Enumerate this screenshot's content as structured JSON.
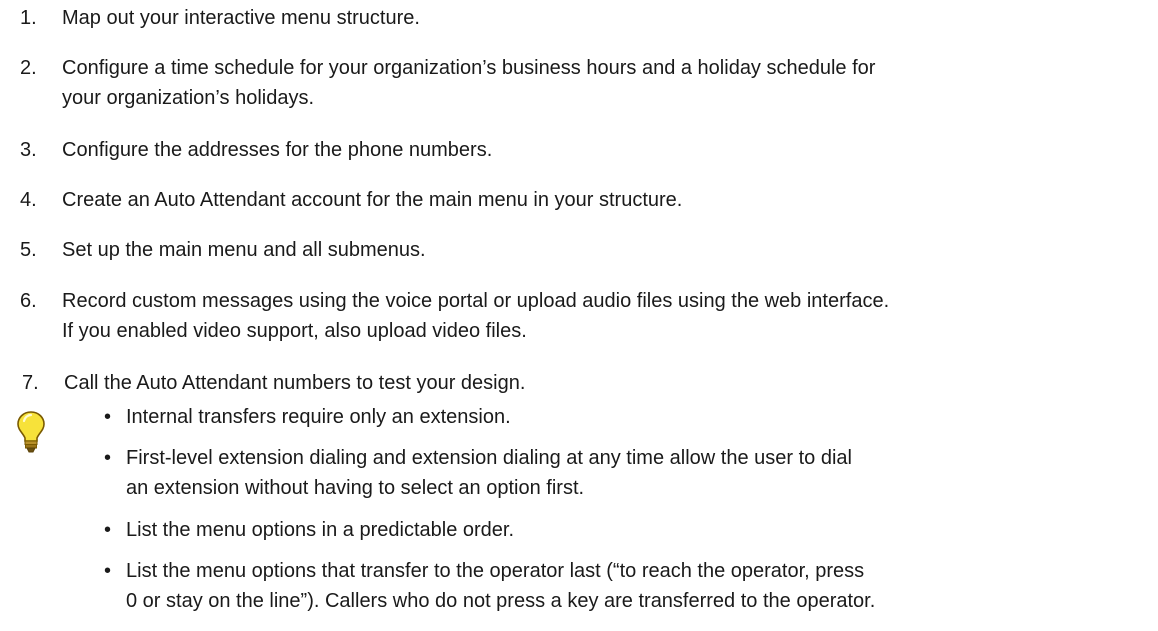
{
  "steps": [
    {
      "num": "1.",
      "lines": [
        "Map out your interactive menu structure."
      ]
    },
    {
      "num": "2.",
      "lines": [
        "Configure a time schedule for your organization’s business hours and a holiday schedule for",
        "your organization’s holidays."
      ]
    },
    {
      "num": "3.",
      "lines": [
        "Configure the addresses for the phone numbers."
      ]
    },
    {
      "num": "4.",
      "lines": [
        "Create an Auto Attendant account for the main menu in your structure."
      ]
    },
    {
      "num": "5.",
      "lines": [
        "Set up the main menu and all submenus."
      ]
    },
    {
      "num": "6.",
      "lines": [
        "Record custom messages using the voice portal or upload audio files using the web interface.",
        "If you enabled video support, also upload video files."
      ]
    },
    {
      "num": "7.",
      "lines": [
        "Call the Auto Attendant numbers to test your design."
      ]
    }
  ],
  "tips": {
    "icon": "lightbulb-icon",
    "bullet": "•",
    "items": [
      {
        "lines": [
          "Internal transfers require only an extension."
        ]
      },
      {
        "lines": [
          "First-level extension dialing and extension dialing at any time allow the user to dial",
          "an extension without having to select an option first."
        ]
      },
      {
        "lines": [
          "List the menu options in a predictable order."
        ]
      },
      {
        "lines": [
          "List the menu options that transfer to the operator last (“to reach the operator, press",
          "0 or stay on the line”). Callers who do not press a key are transferred to the operator."
        ]
      }
    ]
  },
  "colors": {
    "text": "#1a1a1a",
    "bulb_fill": "#f7e23a",
    "bulb_outline": "#7a5a00",
    "bulb_base": "#8a6a10"
  }
}
